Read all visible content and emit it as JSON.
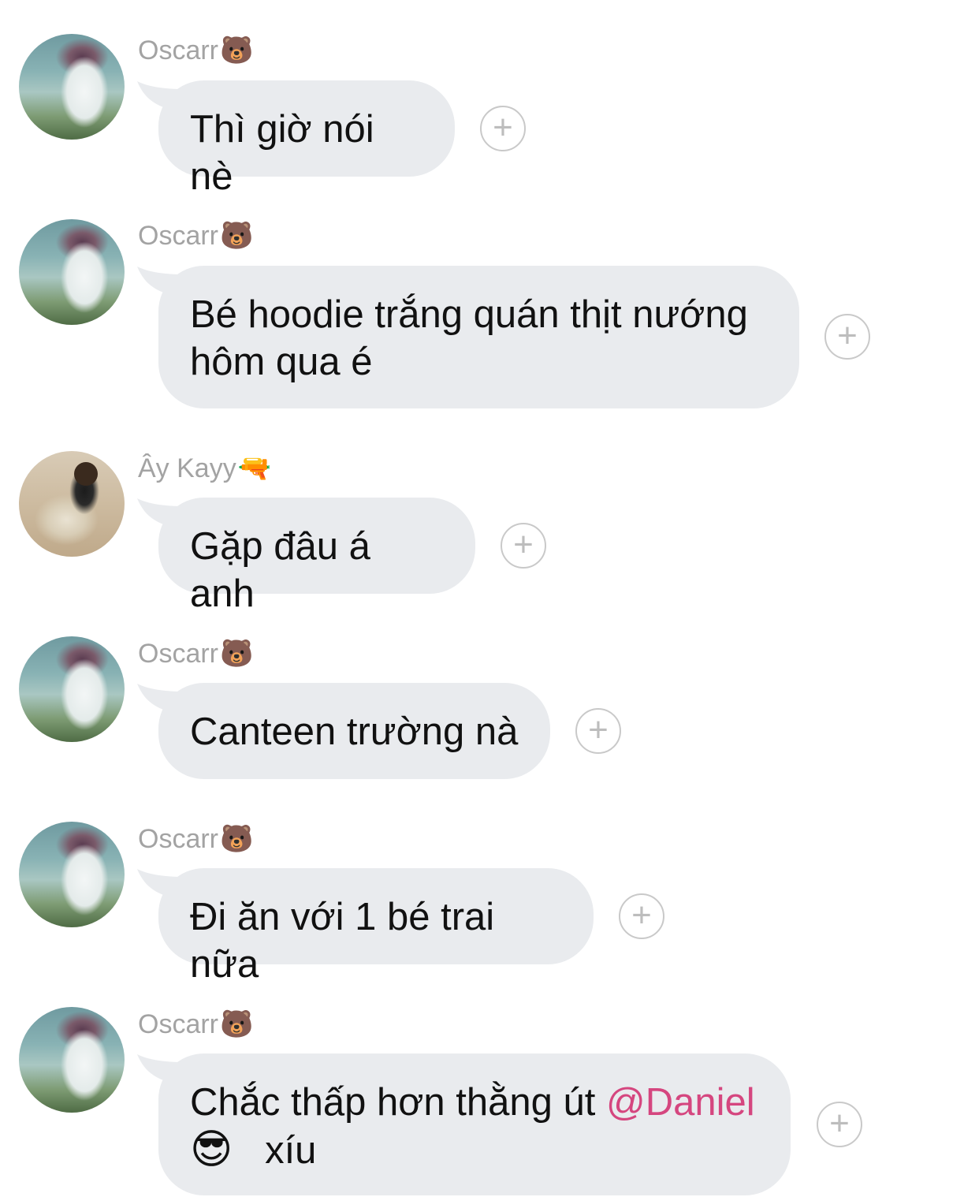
{
  "colors": {
    "bubble": "#e9ebee",
    "name": "#a3a3a3",
    "mention": "#d5467f",
    "react_border": "#c9c9c9"
  },
  "messages": [
    {
      "sender": "Oscarr",
      "sender_emoji": "🐻",
      "avatar": "oscar-avatar",
      "lines": [
        "Thì giờ nói nè"
      ]
    },
    {
      "sender": "Oscarr",
      "sender_emoji": "🐻",
      "avatar": "oscar-avatar",
      "lines": [
        "Bé hoodie trắng quán thịt nướng",
        "hôm qua é"
      ]
    },
    {
      "sender": "Ây Kayy",
      "sender_emoji": "🔫",
      "avatar": "kayy-avatar",
      "lines": [
        "Gặp đâu á anh"
      ]
    },
    {
      "sender": "Oscarr",
      "sender_emoji": "🐻",
      "avatar": "oscar-avatar",
      "lines": [
        "Canteen trường nà"
      ]
    },
    {
      "sender": "Oscarr",
      "sender_emoji": "🐻",
      "avatar": "oscar-avatar",
      "lines": [
        "Đi ăn với 1 bé trai nữa"
      ]
    },
    {
      "sender": "Oscarr",
      "sender_emoji": "🐻",
      "avatar": "oscar-avatar",
      "text_before_mention": "Chắc thấp hơn thằng út ",
      "mention": "@Daniel",
      "emoji": "😎",
      "text_after_emoji": "xíu"
    }
  ],
  "react_symbol": "+"
}
